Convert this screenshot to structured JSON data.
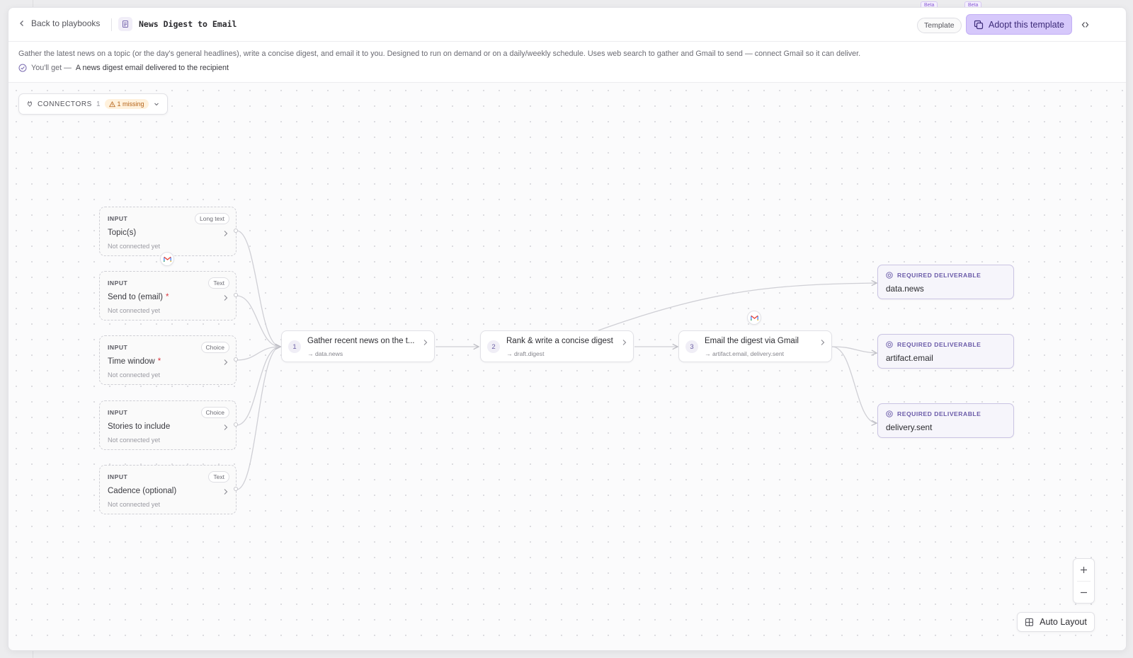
{
  "backdrop": {
    "beta_label": "Beta"
  },
  "header": {
    "back_label": "Back to playbooks",
    "title": "News Digest to Email",
    "template_badge": "Template",
    "adopt_label": "Adopt this template"
  },
  "description": {
    "text": "Gather the latest news on a topic (or the day's general headlines), write a concise digest, and email it to you. Designed to run on demand or on a daily/weekly schedule. Uses web search to gather and Gmail to send — connect Gmail so it can deliver.",
    "get_prefix": "You'll get —",
    "get_value": "A news digest email delivered to the recipient"
  },
  "connectors": {
    "label": "CONNECTORS",
    "count": "1",
    "missing": "1 missing"
  },
  "inputs": [
    {
      "kind": "INPUT",
      "type": "Long text",
      "name": "Topic(s)",
      "required": false,
      "status": "Not connected yet"
    },
    {
      "kind": "INPUT",
      "type": "Text",
      "name": "Send to (email)",
      "required": true,
      "status": "Not connected yet"
    },
    {
      "kind": "INPUT",
      "type": "Choice",
      "name": "Time window",
      "required": true,
      "status": "Not connected yet"
    },
    {
      "kind": "INPUT",
      "type": "Choice",
      "name": "Stories to include",
      "required": false,
      "status": "Not connected yet"
    },
    {
      "kind": "INPUT",
      "type": "Text",
      "name": "Cadence (optional)",
      "required": false,
      "status": "Not connected yet"
    }
  ],
  "required_mark": "*",
  "steps": [
    {
      "number": "1",
      "title": "Gather recent news on the t...",
      "output": "→ data.news"
    },
    {
      "number": "2",
      "title": "Rank & write a concise digest",
      "output": "→ draft.digest"
    },
    {
      "number": "3",
      "title": "Email the digest via Gmail",
      "output": "→ artifact.email, delivery.sent"
    }
  ],
  "deliverables": [
    {
      "label": "REQUIRED DELIVERABLE",
      "name": "data.news"
    },
    {
      "label": "REQUIRED DELIVERABLE",
      "name": "artifact.email"
    },
    {
      "label": "REQUIRED DELIVERABLE",
      "name": "delivery.sent"
    }
  ],
  "controls": {
    "auto_layout_label": "Auto Layout"
  },
  "icons": [
    "chevron-left-icon",
    "document-icon",
    "copy-icon",
    "collapse-icon",
    "check-circle-icon",
    "plug-icon",
    "warning-icon",
    "chevron-down-icon",
    "chevron-right-icon",
    "gmail-icon",
    "target-icon",
    "plus-icon",
    "minus-icon",
    "grid-icon"
  ],
  "colors": {
    "accent": "#d6c8fb",
    "accent_border": "#c2aef5",
    "deliverable_bg": "#f6f5fb",
    "warning": "#b4641a",
    "required": "#d9363e"
  }
}
